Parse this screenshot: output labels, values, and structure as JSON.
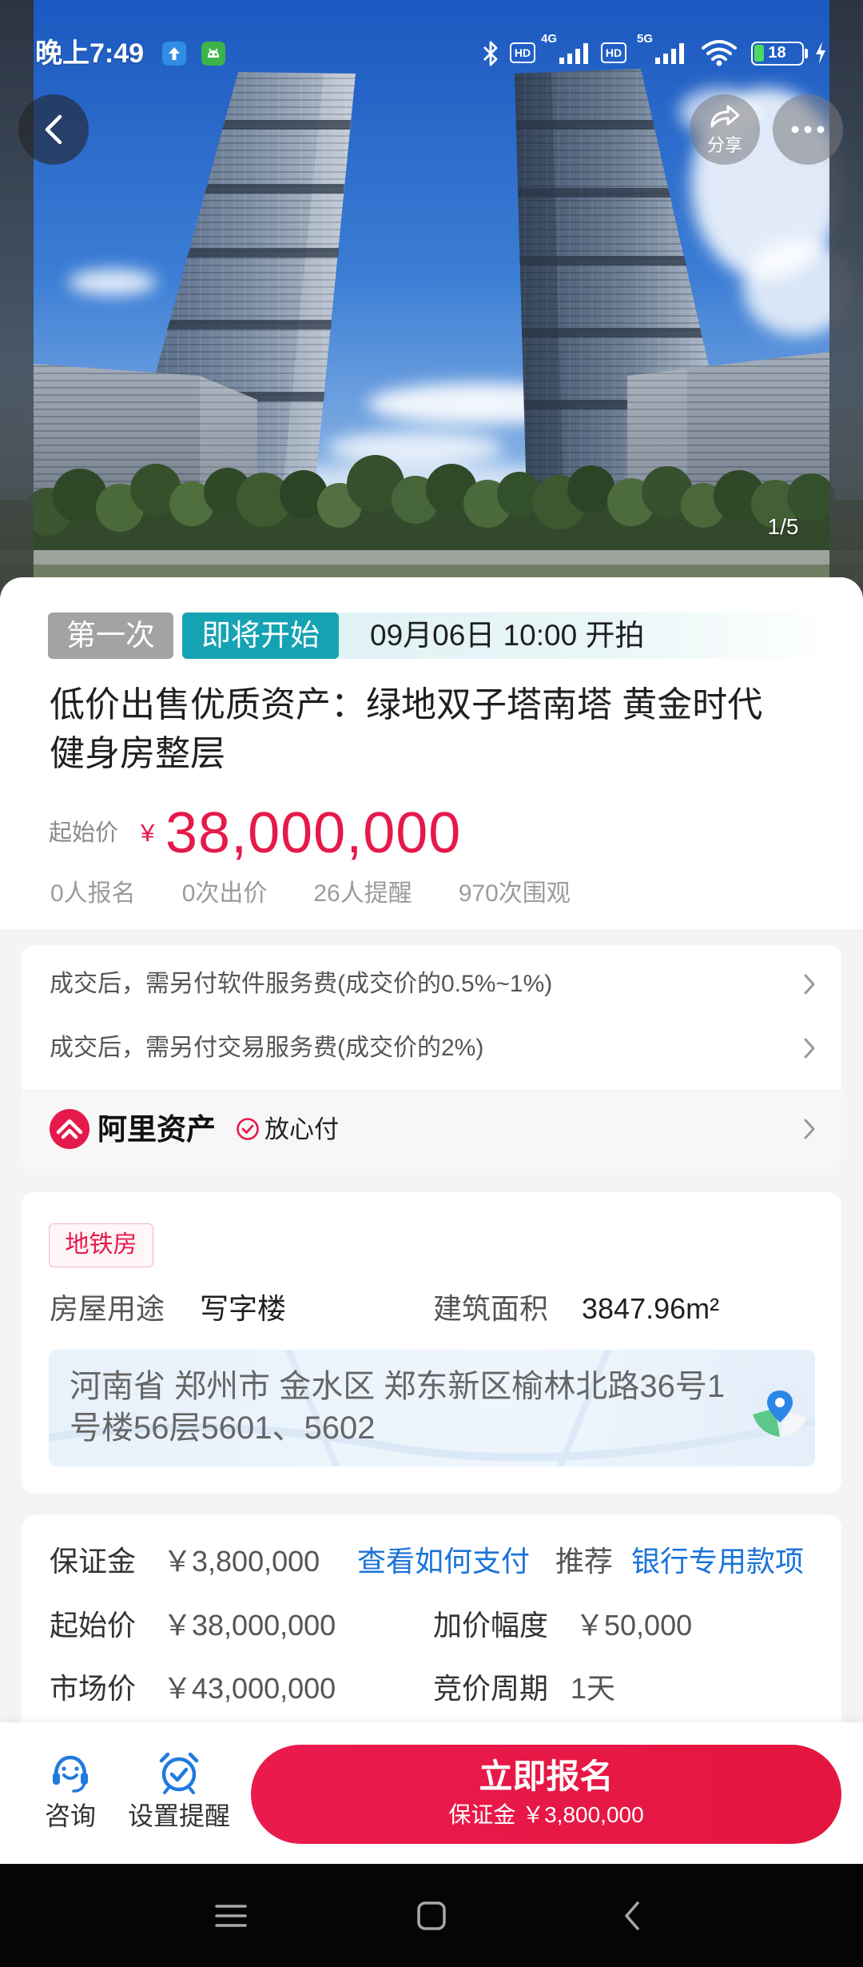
{
  "status_bar": {
    "time": "晚上7:49",
    "hd_1": "HD",
    "network_1": "4G",
    "hd_2": "HD",
    "network_2": "5G",
    "battery": "18"
  },
  "hero": {
    "share_label": "分享",
    "image_counter": "1/5"
  },
  "auction": {
    "round_badge": "第一次",
    "status_badge": "即将开始",
    "start_time": "09月06日 10:00 开拍",
    "title": "低价出售优质资产：绿地双子塔南塔 黄金时代健身房整层",
    "start_price_label": "起始价",
    "currency_symbol": "¥",
    "start_price": "38,000,000",
    "stats": [
      "0人报名",
      "0次出价",
      "26人提醒",
      "970次围观"
    ]
  },
  "fees": {
    "items": [
      "成交后，需另付软件服务费(成交价的0.5%~1%)",
      "成交后，需另付交易服务费(成交价的2%)"
    ],
    "brand_name": "阿里资产",
    "pay_label": "放心付"
  },
  "property": {
    "tag": "地铁房",
    "usage_label": "房屋用途",
    "usage_value": "写字楼",
    "area_label": "建筑面积",
    "area_value": "3847.96m²",
    "address": "河南省 郑州市 金水区 郑东新区榆林北路36号1号楼56层5601、5602"
  },
  "terms": {
    "deposit_label": "保证金",
    "deposit_value": "￥3,800,000",
    "pay_link": "查看如何支付",
    "recommend_label": "推荐",
    "recommend_link": "银行专用款项",
    "start_price_label": "起始价",
    "start_price_value": "￥38,000,000",
    "increment_label": "加价幅度",
    "increment_value": "￥50,000",
    "market_price_label": "市场价",
    "market_price_value": "￥43,000,000",
    "cycle_label": "竞价周期",
    "cycle_value": "1天"
  },
  "bottom_bar": {
    "consult_label": "咨询",
    "reminder_label": "设置提醒",
    "signup_label": "立即报名",
    "signup_sub": "保证金 ￥3,800,000"
  },
  "icons": [
    "back-icon",
    "share-icon",
    "more-icon",
    "chevron-right-icon",
    "alipay-assets-logo",
    "check-circle-icon",
    "map-pin-icon",
    "headset-icon",
    "alarm-clock-icon",
    "menu-icon",
    "home-square-icon",
    "nav-back-icon"
  ],
  "colors": {
    "accent_red": "#e5194a",
    "teal_badge": "#15a3b4",
    "gray_badge": "#a3a3a3",
    "link_blue": "#1a73d9",
    "icon_blue": "#1f7ae0"
  }
}
